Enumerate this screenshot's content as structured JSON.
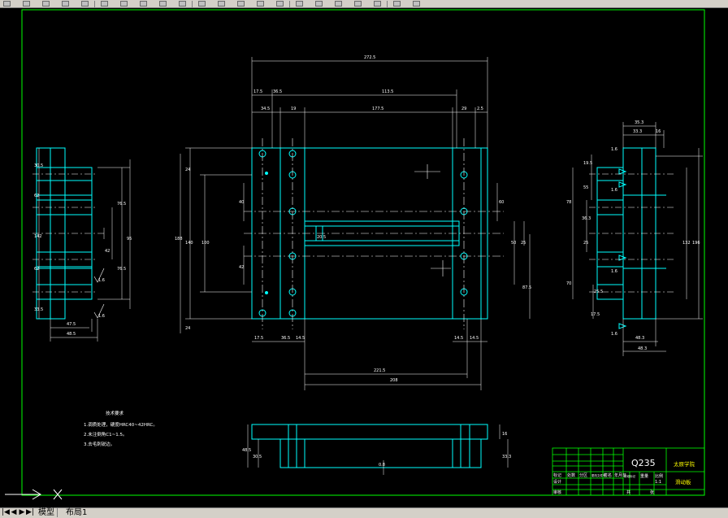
{
  "app": {
    "toolbar_icons": [
      "new-icon",
      "open-icon",
      "save-icon",
      "print-icon",
      "plot-preview-icon",
      "cut-icon",
      "copy-icon",
      "paste-icon",
      "match-properties-icon",
      "undo-icon",
      "redo-icon",
      "pan-icon",
      "zoom-realtime-icon",
      "zoom-window-icon",
      "zoom-previous-icon",
      "properties-icon",
      "design-center-icon",
      "tool-palettes-icon",
      "sheet-set-icon",
      "markup-icon",
      "calculator-icon",
      "help-icon"
    ]
  },
  "drawing": {
    "top_view": {
      "overall_width": "272.5",
      "dim_17_5_top": "17.5",
      "dim_36_5_top": "36.5",
      "dim_113_5": "113.5",
      "dim_34_5": "34.5",
      "dim_19": "19",
      "dim_177_5": "177.5",
      "dim_29": "29",
      "dim_2_5": "2.5",
      "dim_24_left": "24",
      "dim_188": "188",
      "dim_140": "140",
      "dim_100": "100",
      "dim_40": "40",
      "dim_42": "42",
      "dim_24_bottom": "24",
      "dim_60": "60",
      "dim_50": "50",
      "dim_25": "25",
      "dim_87_5": "87.5",
      "dim_17_5_bot": "17.5",
      "dim_36_5_bot": "36.5",
      "dim_14_5_bot": "14.5",
      "dim_14_5_bot2": "14.5",
      "dim_221_5": "221.5",
      "dim_208": "208",
      "dim_center": "20.5"
    },
    "left_view": {
      "dim_30_5": "30.5",
      "dim_62_a": "62",
      "dim_142": "142",
      "dim_62_b": "62",
      "dim_33_5": "33.5",
      "dim_76_5": "76.5",
      "dim_42": "42",
      "dim_76_5b": "76.5",
      "dim_47_5": "47.5",
      "dim_48_5": "48.5",
      "rough_a": "1.6",
      "rough_b": "1.6",
      "dim_95": "95"
    },
    "right_view": {
      "dim_35_3": "35.3",
      "dim_33_3": "33.3",
      "dim_16": "16",
      "dim_19_5": "19.5",
      "dim_55": "55",
      "dim_78": "78",
      "dim_96_3": "36.3",
      "dim_25": "25",
      "dim_70": "70",
      "dim_25_5": "25.5",
      "dim_17_5": "17.5",
      "dim_132": "132",
      "dim_196": "196",
      "dim_48_3": "48.3",
      "dim_48_3b": "48.3",
      "rough": "1.6"
    },
    "bottom_view": {
      "dim_48_5": "48.5",
      "dim_30_5": "30.5",
      "dim_33_3": "33.3",
      "dim_16": "16",
      "dim_8_5": "0.8"
    },
    "tech_notes": {
      "title": "技术要求",
      "lines": [
        "1.调质处理，硬度HRC40~42HRC。",
        "2.未注倒角C1~1.5。",
        "3.去毛刺锐边。"
      ]
    },
    "title_block": {
      "material": "Q235",
      "school": "太原学院",
      "part_name": "滑动板",
      "row_labels": [
        "标记",
        "处数",
        "分区",
        "更改文件号",
        "签名",
        "年月日"
      ],
      "design": "设计",
      "review": "审核",
      "process": "工艺",
      "approve": "批准",
      "stage": "阶段标记",
      "weight": "重量",
      "scale": "比例",
      "scale_value": "1:1",
      "sheet": "共",
      "sheet_of": "张"
    }
  },
  "status": {
    "tabs": [
      "模型",
      "布局1"
    ],
    "nav_glyphs": [
      "|◀",
      "◀",
      "▶",
      "▶|"
    ]
  },
  "colors": {
    "background": "#000000",
    "border": "#00ff00",
    "object": "#00ffff",
    "dimension": "#ffffff",
    "centerline": "#ffffff",
    "tool_bg": "#d4d0c8"
  }
}
